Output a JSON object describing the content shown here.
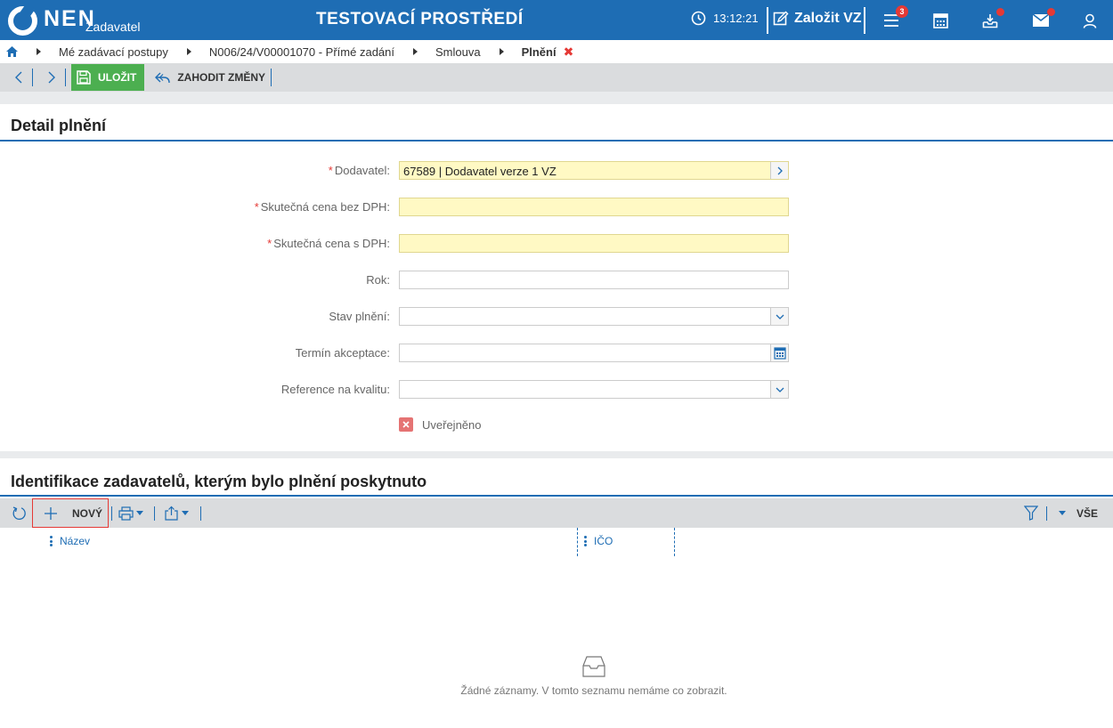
{
  "header": {
    "logo_text": "NEN",
    "logo_sub": "Zadavatel",
    "env_title": "TESTOVACÍ PROSTŘEDÍ",
    "time": "13:12:21",
    "create_label": "Založit VZ",
    "menu_badge": "3",
    "accent_color": "#1e6db4"
  },
  "breadcrumb": {
    "items": [
      "Mé zadávací postupy",
      "N006/24/V00001070 - Přímé zadání",
      "Smlouva",
      "Plnění"
    ],
    "close_glyph": "✖"
  },
  "toolbar": {
    "save_label": "ULOŽIT",
    "discard_label": "ZAHODIT ZMĚNY"
  },
  "detail": {
    "title": "Detail plnění",
    "fields": [
      {
        "label": "Dodavatel:",
        "value": "67589 | Dodavatel verze 1 VZ",
        "required": true
      },
      {
        "label": "Skutečná cena bez DPH:",
        "value": "",
        "required": true
      },
      {
        "label": "Skutečná cena s DPH:",
        "value": "",
        "required": true
      },
      {
        "label": "Rok:",
        "value": "",
        "required": false
      },
      {
        "label": "Stav plnění:",
        "value": "",
        "required": false
      },
      {
        "label": "Termín akceptace:",
        "value": "",
        "required": false
      },
      {
        "label": "Reference na kvalitu:",
        "value": "",
        "required": false
      }
    ],
    "required_mark": "*",
    "published_label": "Uveřejněno",
    "published_checked": false
  },
  "list": {
    "title": "Identifikace zadavatelů, kterým bylo plnění poskytnuto",
    "new_label": "NOVÝ",
    "filter_all_label": "VŠE",
    "columns": [
      "Název",
      "IČO"
    ],
    "empty_text": "Žádné záznamy. V tomto seznamu nemáme co zobrazit."
  }
}
